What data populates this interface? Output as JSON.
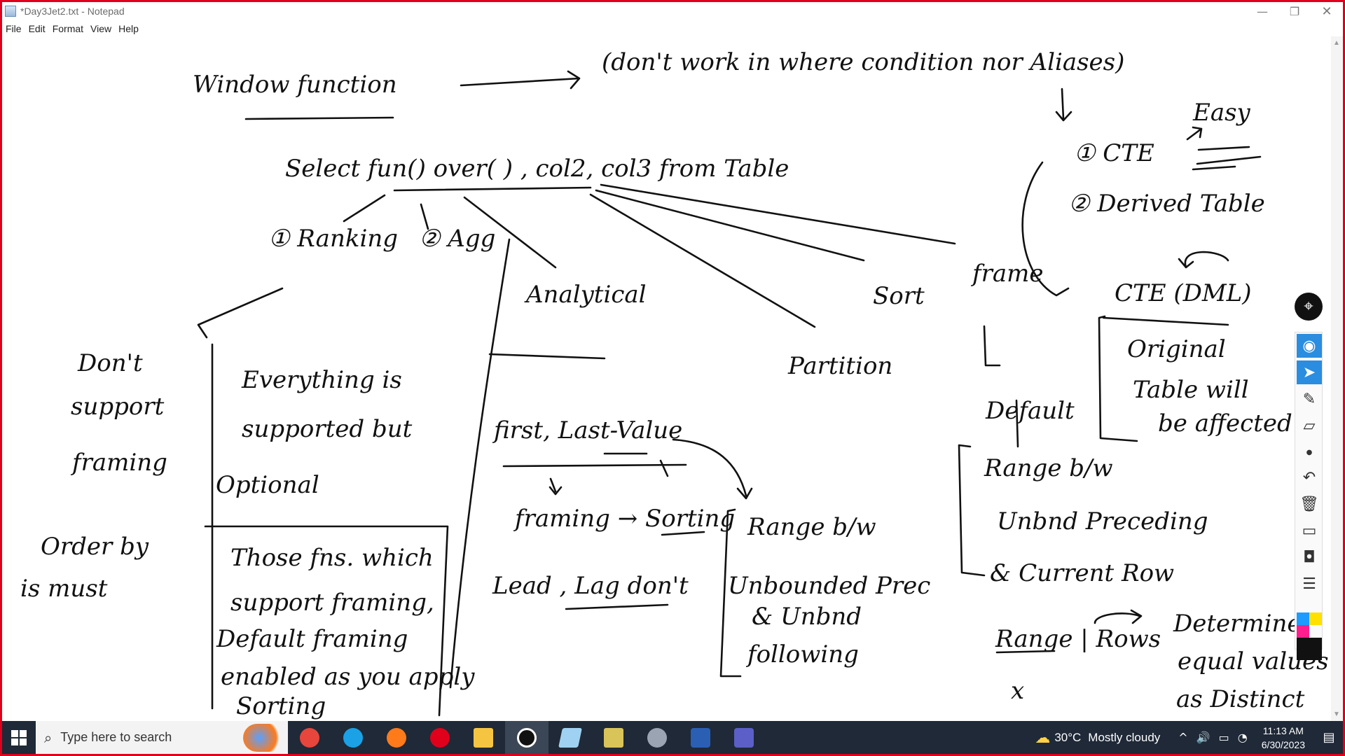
{
  "window": {
    "title": "*Day3Jet2.txt - Notepad",
    "minimize_glyph": "—",
    "maximize_glyph": "❐",
    "close_glyph": "✕"
  },
  "menu": [
    "File",
    "Edit",
    "Format",
    "View",
    "Help"
  ],
  "notes": {
    "window_function": "Window function",
    "dont_work": "(don't work in where condition nor Aliases)",
    "select_line": "Select  fun()  over( ) , col2,  col3   from Table",
    "ranking": "① Ranking",
    "agg": "② Agg",
    "analytical": "Analytical",
    "sort": "Sort",
    "frame": "frame",
    "partition": "Partition",
    "cte": "① CTE",
    "easy": "Easy",
    "derived_table": "② Derived Table",
    "cte_dml": "CTE (DML)",
    "original_table": "Original",
    "table_will": "Table will",
    "be_affected": "be affected",
    "dont_support": "Don't",
    "support": "support",
    "framing": "framing",
    "order_by": "Order by",
    "is_must": "is must",
    "everything_is": "Everything is",
    "supported_but": "supported but",
    "optional": "Optional",
    "those_fns": "Those fns. which",
    "support_framing": "support framing,",
    "default_framing": "Default framing",
    "enabled_as": "enabled as you apply",
    "sorting_word": "Sorting",
    "first_last": "first, Last-Value",
    "framing_sorting": "framing → Sorting",
    "lead_lag": "Lead ,  Lag  don't",
    "range_bw": "Range b/w",
    "unbounded_prec": "Unbounded Prec",
    "and_unbnd": "& Unbnd",
    "following": "following",
    "default_word": "Default",
    "range_bw2": "Range  b/w",
    "unbnd_preceding": "Unbnd  Preceding",
    "current_row": "& Current  Row",
    "range_rows": "Range  | Rows",
    "x_mark": "x",
    "determine": "Determine",
    "equal_values": "equal values",
    "as_distinct": "as Distinct"
  },
  "ink_toolbar": {
    "tools": [
      "pen-badge",
      "eye-icon",
      "pointer-icon",
      "highlighter-icon",
      "eraser-icon",
      "dot-icon",
      "undo-icon",
      "trash-icon",
      "whiteboard-icon",
      "camera-icon",
      "clipboard-icon"
    ],
    "colors": [
      "#1e9bff",
      "#ffe000",
      "#ff1e8c",
      "#111111"
    ]
  },
  "taskbar": {
    "search_placeholder": "Type here to search",
    "apps": [
      "chrome-icon",
      "edge-icon",
      "firefox-icon",
      "opera-icon",
      "file-explorer-icon",
      "epic-pen-icon",
      "notepad-icon",
      "paint-tool-icon",
      "settings-icon",
      "word-icon",
      "teams-icon"
    ],
    "app_colors": [
      "#e8453c",
      "#1aa1e6",
      "#ff7a1a",
      "#e0001b",
      "#f5c542",
      "#ffffff",
      "#9fd2f2",
      "#d9c45a",
      "#9aa4b2",
      "#2b5fb4",
      "#5b5fc7"
    ],
    "weather_temp": "30°C",
    "weather_text": "Mostly cloudy",
    "time": "11:13 AM",
    "date": "6/30/2023"
  }
}
